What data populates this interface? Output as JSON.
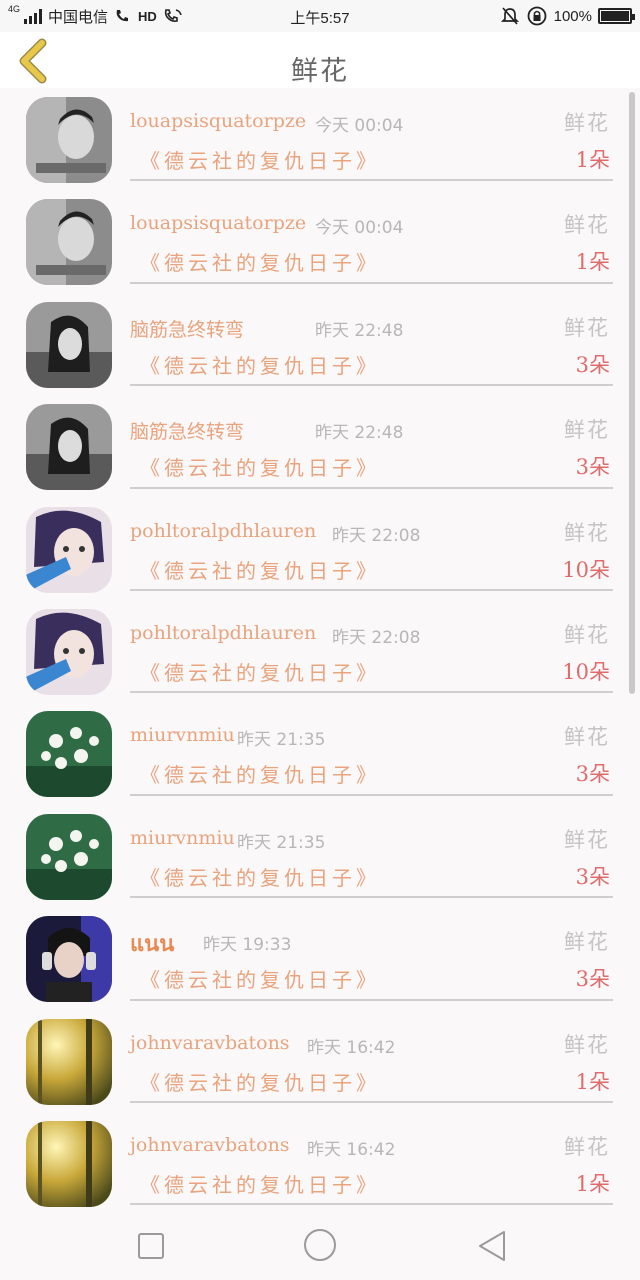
{
  "status_bar": {
    "network": "4G",
    "carrier": "中国电信",
    "hd": "HD",
    "time": "上午5:57",
    "battery": "100%"
  },
  "header": {
    "title": "鲜花"
  },
  "rows": [
    {
      "name": "louapsisquatorpze",
      "time": "今天 00:04",
      "gift": "鲜花",
      "book": "《德云社的复仇日子》",
      "count": "1朵",
      "avatar": "avatar-man"
    },
    {
      "name": "louapsisquatorpze",
      "time": "今天 00:04",
      "gift": "鲜花",
      "book": "《德云社的复仇日子》",
      "count": "1朵",
      "avatar": "avatar-man"
    },
    {
      "name": "脑筋急终转弯",
      "time": "昨天 22:48",
      "gift": "鲜花",
      "book": "《德云社的复仇日子》",
      "count": "3朵",
      "avatar": "avatar-girl-bw"
    },
    {
      "name": "脑筋急终转弯",
      "time": "昨天 22:48",
      "gift": "鲜花",
      "book": "《德云社的复仇日子》",
      "count": "3朵",
      "avatar": "avatar-girl-bw"
    },
    {
      "name": "pohltoralpdhlauren",
      "time": "昨天 22:08",
      "gift": "鲜花",
      "book": "《德云社的复仇日子》",
      "count": "10朵",
      "avatar": "avatar-cosplay"
    },
    {
      "name": "pohltoralpdhlauren",
      "time": "昨天 22:08",
      "gift": "鲜花",
      "book": "《德云社的复仇日子》",
      "count": "10朵",
      "avatar": "avatar-cosplay"
    },
    {
      "name": "miurvnmiu",
      "time": "昨天 21:35",
      "gift": "鲜花",
      "book": "《德云社的复仇日子》",
      "count": "3朵",
      "avatar": "avatar-flowers"
    },
    {
      "name": "miurvnmiu",
      "time": "昨天 21:35",
      "gift": "鲜花",
      "book": "《德云社的复仇日子》",
      "count": "3朵",
      "avatar": "avatar-flowers"
    },
    {
      "name": "แนน",
      "time": "昨天 19:33",
      "gift": "鲜花",
      "book": "《德云社的复仇日子》",
      "count": "3朵",
      "avatar": "avatar-headphones"
    },
    {
      "name": "johnvaravbatons",
      "time": "昨天 16:42",
      "gift": "鲜花",
      "book": "《德云社的复仇日子》",
      "count": "1朵",
      "avatar": "avatar-forest"
    },
    {
      "name": "johnvaravbatons",
      "time": "昨天 16:42",
      "gift": "鲜花",
      "book": "《德云社的复仇日子》",
      "count": "1朵",
      "avatar": "avatar-forest"
    }
  ],
  "colors": {
    "username": "#e9a37d",
    "count": "#e06b6b",
    "muted": "#c4c4c4",
    "back_arrow": "#e8c84a"
  }
}
